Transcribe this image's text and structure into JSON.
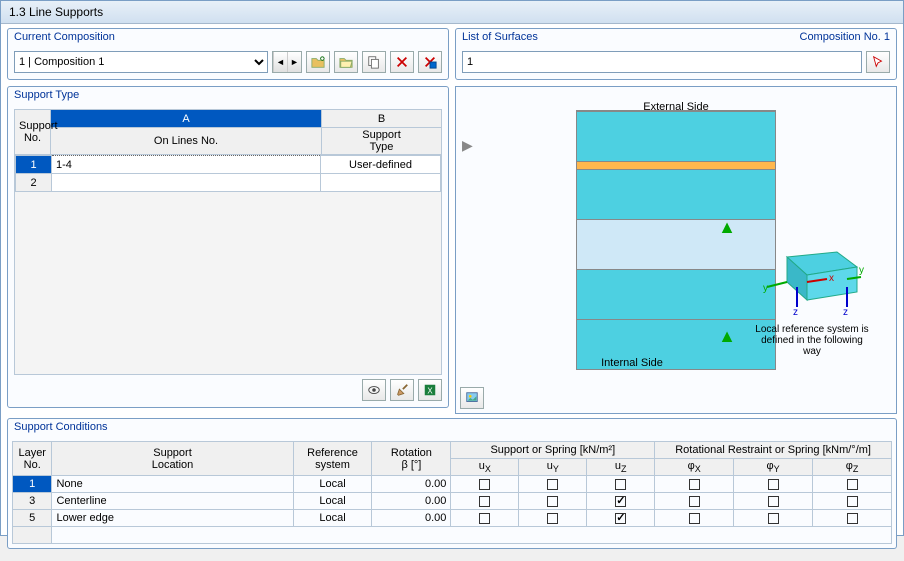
{
  "window": {
    "title": "1.3 Line Supports"
  },
  "composition": {
    "label": "Current Composition",
    "selected": "1 | Composition 1"
  },
  "surfaces": {
    "label": "List of Surfaces",
    "compno_label": "Composition No. 1",
    "value": "1"
  },
  "support_type": {
    "label": "Support Type",
    "col_A": "A",
    "col_B": "B",
    "col_support_no": "Support\nNo.",
    "col_on_lines": "On Lines No.",
    "col_type": "Support\nType",
    "rows": [
      {
        "no": "1",
        "lines": "1-4",
        "type": "User-defined"
      },
      {
        "no": "2",
        "lines": "",
        "type": ""
      }
    ]
  },
  "preview": {
    "external": "External Side",
    "internal": "Internal Side",
    "axis_text": "Local reference system is defined in the following way"
  },
  "conditions": {
    "label": "Support Conditions",
    "col_layer_no": "Layer\nNo.",
    "col_support_loc": "Support\nLocation",
    "col_ref_sys": "Reference\nsystem",
    "col_rotation": "Rotation\nβ [°]",
    "group_spring": "Support or Spring [kN/m²]",
    "group_rot": "Rotational Restraint or Spring [kNm/°/m]",
    "col_ux": "u",
    "col_ux_sub": "X",
    "col_uy": "u",
    "col_uy_sub": "Y",
    "col_uz": "u",
    "col_uz_sub": "Z",
    "col_phix": "φ",
    "col_phix_sub": "X",
    "col_phiy": "φ",
    "col_phiy_sub": "Y",
    "col_phiz": "φ",
    "col_phiz_sub": "Z",
    "rows": [
      {
        "no": "1",
        "loc": "None",
        "sys": "Local",
        "rot": "0.00",
        "ux": false,
        "uy": false,
        "uz": false,
        "phix": false,
        "phiy": false,
        "phiz": false
      },
      {
        "no": "3",
        "loc": "Centerline",
        "sys": "Local",
        "rot": "0.00",
        "ux": false,
        "uy": false,
        "uz": true,
        "phix": false,
        "phiy": false,
        "phiz": false
      },
      {
        "no": "5",
        "loc": "Lower edge",
        "sys": "Local",
        "rot": "0.00",
        "ux": false,
        "uy": false,
        "uz": true,
        "phix": false,
        "phiy": false,
        "phiz": false
      }
    ]
  },
  "icons": {
    "prev": "◄",
    "next": "►",
    "new": "new",
    "open": "open",
    "copy": "copy",
    "delete": "del",
    "xml": "xml",
    "eye": "eye",
    "pick": "pick",
    "excel": "xls",
    "img": "img",
    "cursor": "cur"
  }
}
